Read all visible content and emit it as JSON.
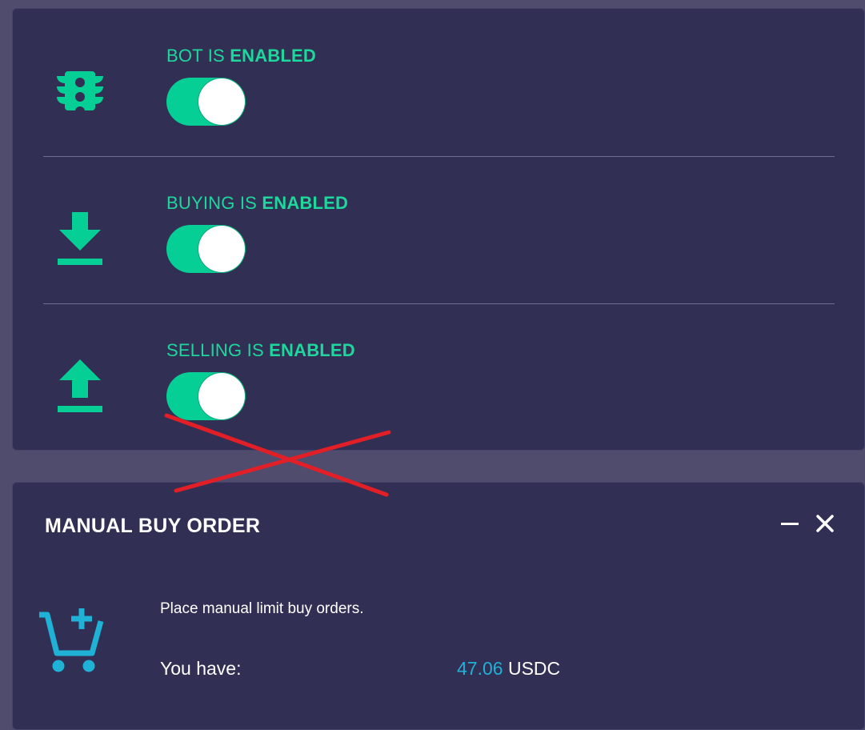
{
  "colors": {
    "accent_green": "#06cf95",
    "accent_cyan": "#1fb1d6",
    "card_bg": "#312f54",
    "page_bg": "#4f4c6e",
    "annotation_red": "#e21f26"
  },
  "toggles": [
    {
      "prefix": "BOT IS ",
      "state": "ENABLED",
      "icon": "traffic-light-icon",
      "on": true
    },
    {
      "prefix": "BUYING IS ",
      "state": "ENABLED",
      "icon": "download-icon",
      "on": true
    },
    {
      "prefix": "SELLING IS ",
      "state": "ENABLED",
      "icon": "upload-icon",
      "on": true
    }
  ],
  "manual_buy": {
    "title": "MANUAL BUY ORDER",
    "description": "Place manual limit buy orders.",
    "have_label": "You have:",
    "amount": "47.06",
    "currency": "USDC",
    "icon": "cart-plus-icon",
    "minimize_icon": "minimize-icon",
    "close_icon": "close-icon"
  }
}
